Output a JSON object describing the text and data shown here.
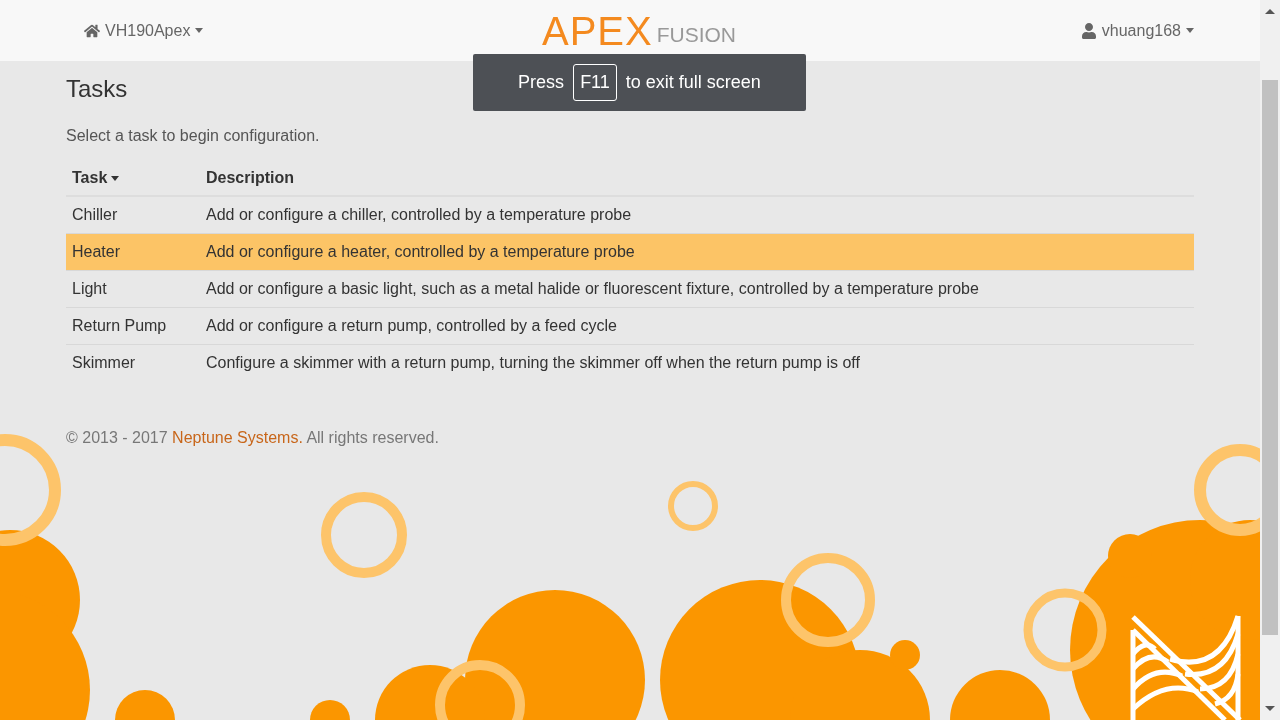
{
  "navbar": {
    "device": "VH190Apex",
    "logo": {
      "main": "APEX",
      "sub": "FUSION"
    },
    "user": "vhuang168"
  },
  "toast": {
    "before": "Press",
    "key": "F11",
    "after": "to exit full screen"
  },
  "page": {
    "title": "Tasks",
    "subtitle": "Select a task to begin configuration."
  },
  "table": {
    "columns": [
      {
        "label": "Task",
        "sorted": true
      },
      {
        "label": "Description",
        "sorted": false
      }
    ],
    "rows": [
      {
        "task": "Chiller",
        "description": "Add or configure a chiller, controlled by a temperature probe",
        "selected": false
      },
      {
        "task": "Heater",
        "description": "Add or configure a heater, controlled by a temperature probe",
        "selected": true
      },
      {
        "task": "Light",
        "description": "Add or configure a basic light, such as a metal halide or fluorescent fixture, controlled by a temperature probe",
        "selected": false
      },
      {
        "task": "Return Pump",
        "description": "Add or configure a return pump, controlled by a feed cycle",
        "selected": false
      },
      {
        "task": "Skimmer",
        "description": "Configure a skimmer with a return pump, turning the skimmer off when the return pump is off",
        "selected": false
      }
    ]
  },
  "footer": {
    "copyright": "© 2013 - 2017",
    "link": "Neptune Systems.",
    "rest": "All rights reserved."
  }
}
